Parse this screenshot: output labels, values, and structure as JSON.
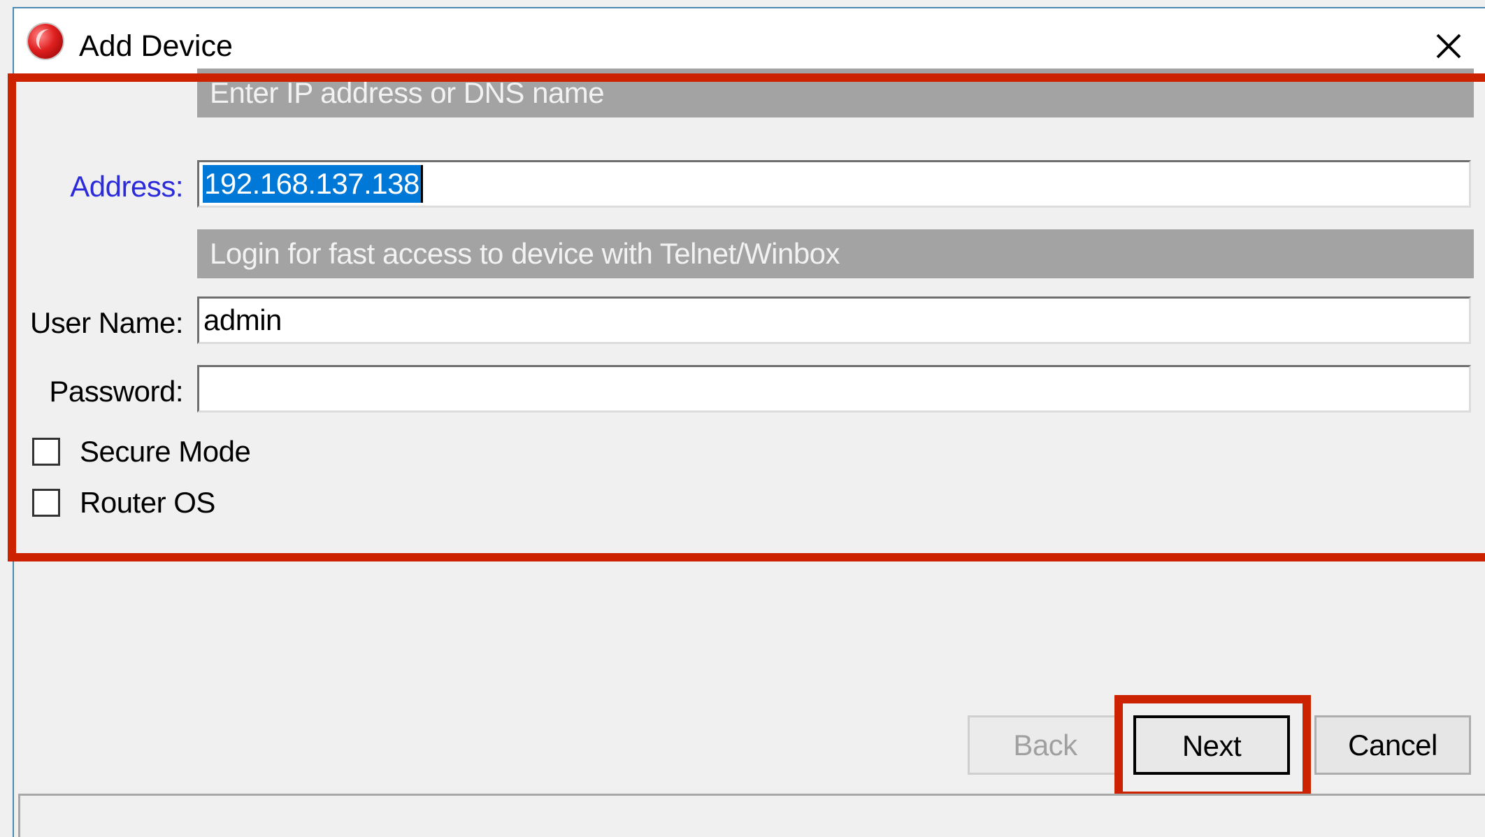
{
  "window": {
    "title": "Add Device",
    "icon": "red-sphere-app-icon",
    "close_icon": "close-icon"
  },
  "address_section": {
    "header": "Enter IP address or DNS name",
    "label": "Address:",
    "value": "192.168.137.138",
    "value_selected": true
  },
  "login_section": {
    "header": "Login for fast access to device with Telnet/Winbox",
    "username_label": "User Name:",
    "username_value": "admin",
    "password_label": "Password:",
    "password_value": ""
  },
  "options": {
    "secure_mode_label": "Secure Mode",
    "secure_mode_checked": false,
    "router_os_label": "Router OS",
    "router_os_checked": false
  },
  "buttons": {
    "back_label": "Back",
    "back_enabled": false,
    "next_label": "Next",
    "cancel_label": "Cancel"
  },
  "colors": {
    "highlight": "#cc2200",
    "section_header_bg": "#a3a3a3",
    "address_label": "#2b2bdc",
    "selection": "#0078d7"
  }
}
